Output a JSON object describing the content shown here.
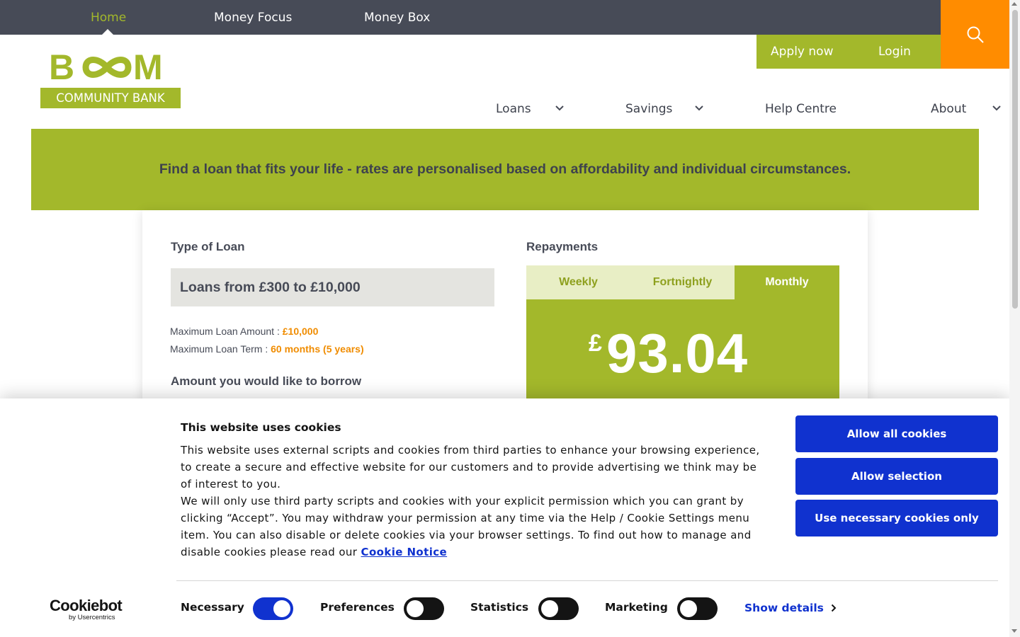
{
  "topnav": {
    "home": "Home",
    "money_focus": "Money Focus",
    "money_box": "Money Box"
  },
  "header": {
    "apply_now": "Apply now",
    "login": "Login",
    "search_icon": "search-icon",
    "logo_word": "BOOM",
    "logo_sub": "COMMUNITY BANK"
  },
  "mainnav": {
    "loans": "Loans",
    "savings": "Savings",
    "help_centre": "Help Centre",
    "about": "About"
  },
  "banner": {
    "text": "Find a loan that fits your life - rates are personalised based on affordability and individual circumstances."
  },
  "calculator": {
    "type_label": "Type of Loan",
    "selected_loan": "Loans from £300 to £10,000",
    "max_amount_label": "Maximum Loan Amount :",
    "max_amount_value": "£10,000",
    "max_term_label": "Maximum Loan Term :",
    "max_term_value": "60 months (5 years)",
    "borrow_label": "Amount you would like to borrow",
    "repayments_label": "Repayments",
    "tabs": [
      "Weekly",
      "Fortnightly",
      "Monthly"
    ],
    "active_tab": "Monthly",
    "currency": "£",
    "amount": "93.04"
  },
  "cookie": {
    "title": "This website uses cookies",
    "para1": "This website uses external scripts and cookies from third parties to enhance your browsing experience, to create a secure and effective website for our customers and to provide advertising we think may be of interest to you.",
    "para2": "We will only use third party scripts and cookies with your explicit permission which you can grant by clicking “Accept”. You may withdraw your permission at any time via the Help / Cookie Settings menu item. You can also disable or delete cookies via your browser settings. To find out how to manage and disable cookies please read our",
    "notice_link": "Cookie Notice",
    "allow_all": "Allow all cookies",
    "allow_selection": "Allow selection",
    "necessary_only": "Use necessary cookies only",
    "toggles": [
      {
        "label": "Necessary",
        "on": true
      },
      {
        "label": "Preferences",
        "on": false
      },
      {
        "label": "Statistics",
        "on": false
      },
      {
        "label": "Marketing",
        "on": false
      }
    ],
    "show_details": "Show details",
    "cookiebot_word": "Cookiebot",
    "cookiebot_sub": "by Usercentrics"
  },
  "colors": {
    "brand_green": "#a3b82b",
    "topbar": "#474b57",
    "search_orange": "#ff8c00",
    "accent_orange": "#f08c00",
    "cookie_blue": "#1032cf"
  }
}
